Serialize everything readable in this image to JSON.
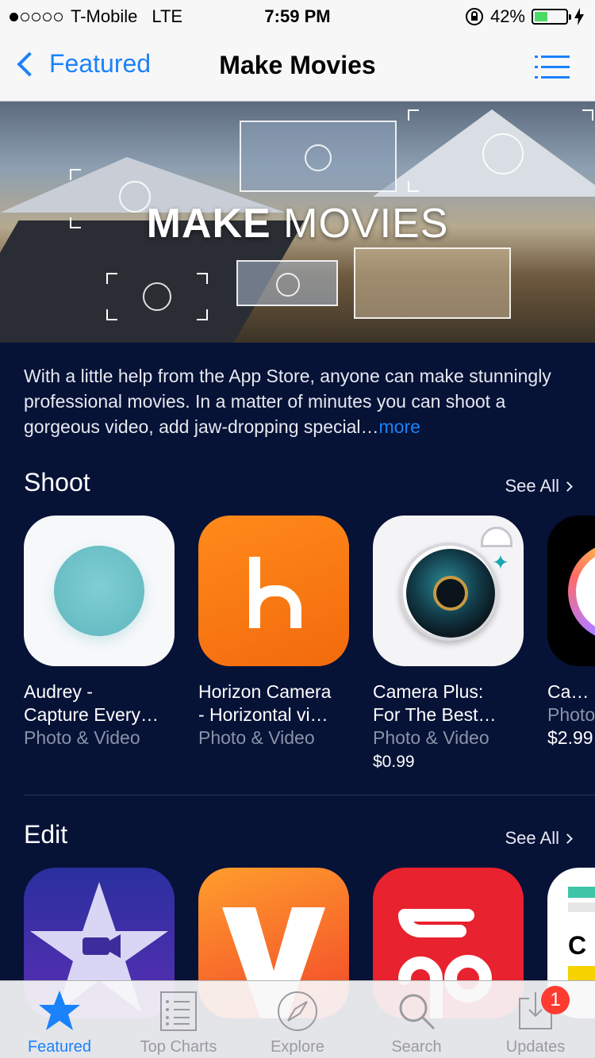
{
  "status_bar": {
    "carrier": "T-Mobile",
    "network": "LTE",
    "time": "7:59 PM",
    "battery": "42%",
    "battery_level": 0.42
  },
  "nav": {
    "back_label": "Featured",
    "title": "Make Movies",
    "list_icon": "list-icon"
  },
  "hero": {
    "title_bold": "MAKE",
    "title_light": "MOVIES"
  },
  "description": {
    "text": "With a little help from the App Store, anyone can make stunningly professional movies. In a matter of minutes you can shoot a gorgeous video, add jaw-dropping special…",
    "more_label": "more"
  },
  "sections": [
    {
      "title": "Shoot",
      "see_all": "See All",
      "apps": [
        {
          "name_line1": "Audrey -",
          "name_line2": "Capture Every…",
          "category": "Photo & Video",
          "price": ""
        },
        {
          "name_line1": "Horizon Camera",
          "name_line2": "- Horizontal vi…",
          "category": "Photo & Video",
          "price": ""
        },
        {
          "name_line1": "Camera Plus:",
          "name_line2": "For The Best…",
          "category": "Photo & Video",
          "price": "$0.99"
        },
        {
          "name_line1": "Came",
          "name_line2": "Photo",
          "category": "$2.99",
          "price": ""
        }
      ]
    },
    {
      "title": "Edit",
      "see_all": "See All"
    }
  ],
  "tabs": [
    {
      "label": "Featured",
      "icon": "star-icon",
      "active": true
    },
    {
      "label": "Top Charts",
      "icon": "list-icon"
    },
    {
      "label": "Explore",
      "icon": "compass-icon"
    },
    {
      "label": "Search",
      "icon": "search-icon"
    },
    {
      "label": "Updates",
      "icon": "download-icon",
      "badge": "1"
    }
  ],
  "colors": {
    "accent": "#1a82fb",
    "background": "#061236",
    "badge": "#ff3b30"
  }
}
